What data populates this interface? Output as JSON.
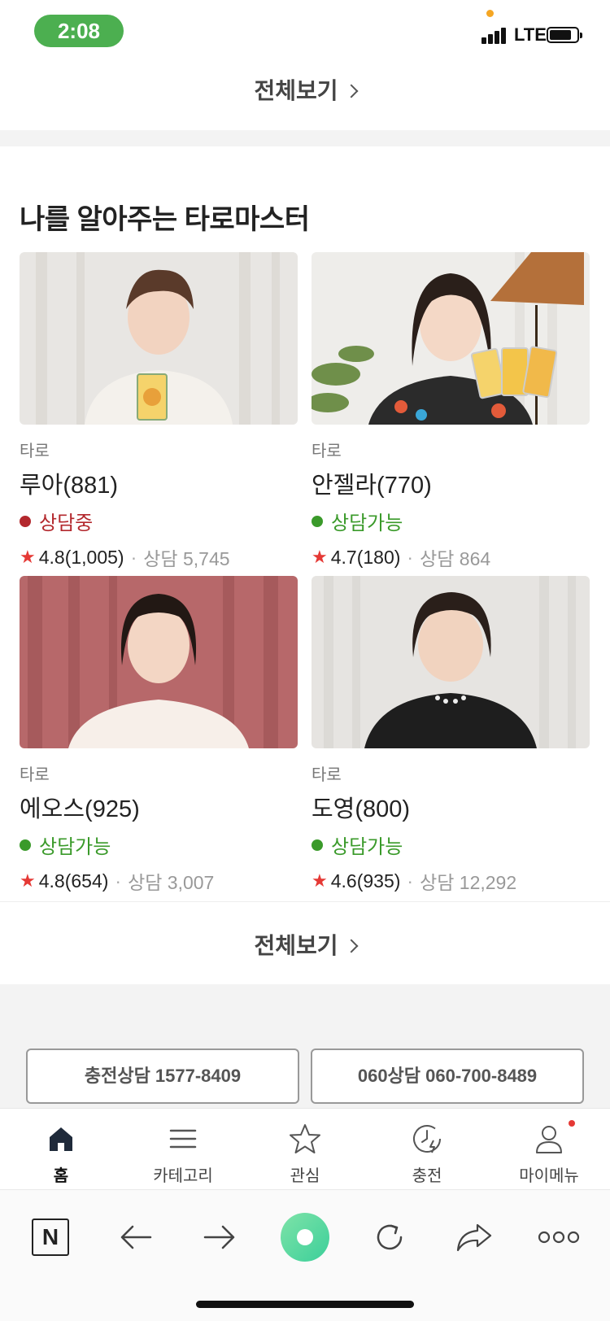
{
  "status_bar": {
    "time": "2:08",
    "network": "LTE"
  },
  "top_view_all": {
    "label": "전체보기"
  },
  "section": {
    "title": "나를 알아주는 타로마스터",
    "cards": [
      {
        "category": "타로",
        "name": "루아(881)",
        "status": "상담중",
        "status_color": "#b3282d",
        "rating": "4.8(1,005)",
        "consult_label": "상담 5,745"
      },
      {
        "category": "타로",
        "name": "안젤라(770)",
        "status": "상담가능",
        "status_color": "#3a9a2a",
        "rating": "4.7(180)",
        "consult_label": "상담 864"
      },
      {
        "category": "타로",
        "name": "에오스(925)",
        "status": "상담가능",
        "status_color": "#3a9a2a",
        "rating": "4.8(654)",
        "consult_label": "상담 3,007"
      },
      {
        "category": "타로",
        "name": "도영(800)",
        "status": "상담가능",
        "status_color": "#3a9a2a",
        "rating": "4.6(935)",
        "consult_label": "상담 12,292"
      }
    ],
    "view_all": "전체보기"
  },
  "phone_buttons": {
    "charge": "충전상담 1577-8409",
    "line060": "060상담 060-700-8489"
  },
  "tabbar": {
    "items": [
      {
        "label": "홈",
        "icon": "home-icon"
      },
      {
        "label": "카테고리",
        "icon": "menu-icon"
      },
      {
        "label": "관심",
        "icon": "star-icon"
      },
      {
        "label": "충전",
        "icon": "clock-charge-icon"
      },
      {
        "label": "마이메뉴",
        "icon": "person-icon"
      }
    ]
  },
  "browser": {
    "logo": "N",
    "icons": [
      "naver-logo-icon",
      "back-arrow-icon",
      "forward-arrow-icon",
      "green-circle-icon",
      "refresh-icon",
      "share-icon",
      "more-icon"
    ]
  }
}
